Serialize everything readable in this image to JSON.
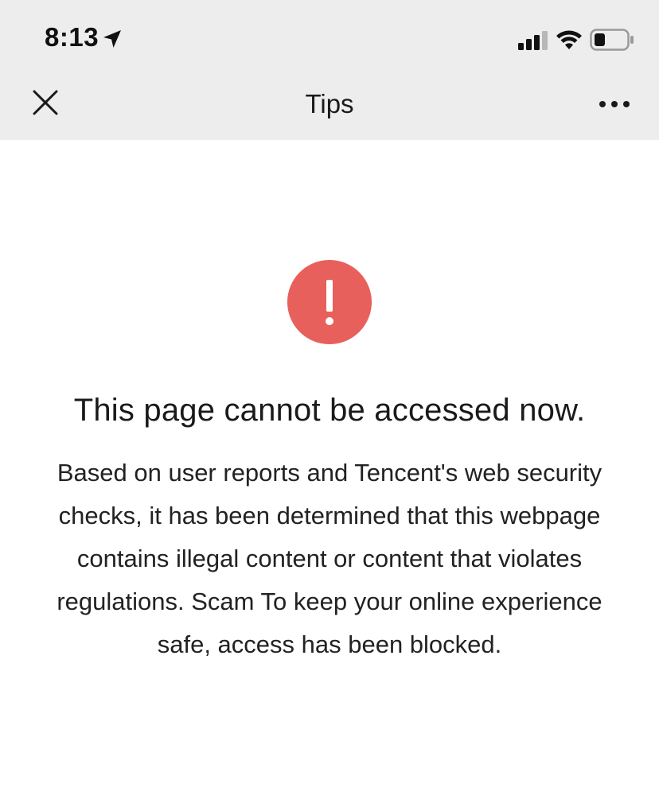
{
  "status_bar": {
    "time": "8:13",
    "location_icon": "location-arrow-icon",
    "signal_icon": "cellular-signal-icon",
    "wifi_icon": "wifi-icon",
    "battery_icon": "battery-icon",
    "battery_level": 0.35
  },
  "nav_bar": {
    "title": "Tips",
    "close_icon": "close-icon",
    "more_icon": "more-dots-icon"
  },
  "alert": {
    "icon": "exclamation-icon",
    "icon_color": "#e8605b",
    "heading": "This page cannot be accessed now.",
    "message": "Based on user reports and Tencent's web security checks, it has been determined that this webpage contains illegal content or content that violates regulations. Scam To keep your online experience safe, access has been blocked."
  },
  "colors": {
    "chrome_background": "#ededed",
    "page_background": "#ffffff",
    "text": "#1a1a1a"
  }
}
